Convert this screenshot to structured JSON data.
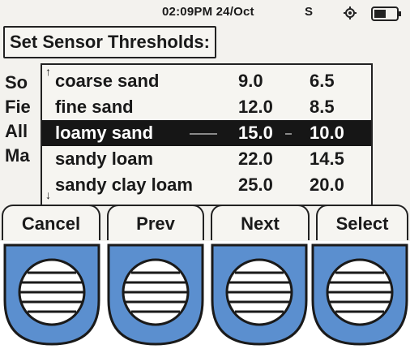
{
  "status": {
    "time": "02:09PM 24/Oct",
    "indicator": "S",
    "gps_icon": "gps-target-icon",
    "battery_icon": "battery-icon"
  },
  "title": "Set Sensor Thresholds:",
  "background_items": [
    "So",
    "Fie",
    "All",
    "Ma"
  ],
  "popup": {
    "scroll_up": "↑",
    "scroll_down": "↓",
    "rows": [
      {
        "name": "coarse sand",
        "v1": "9.0",
        "v2": "6.5",
        "selected": false
      },
      {
        "name": "fine sand",
        "v1": "12.0",
        "v2": "8.5",
        "selected": false
      },
      {
        "name": "loamy sand",
        "v1": "15.0",
        "v2": "10.0",
        "selected": true
      },
      {
        "name": "sandy loam",
        "v1": "22.0",
        "v2": "14.5",
        "selected": false
      },
      {
        "name": "sandy clay loam",
        "v1": "25.0",
        "v2": "20.0",
        "selected": false
      }
    ]
  },
  "softkeys": [
    "Cancel",
    "Prev",
    "Next",
    "Select"
  ],
  "colors": {
    "button_blue": "#5b8fcf",
    "screen_bg": "#f3f2ee",
    "selected_bg": "#161616"
  }
}
